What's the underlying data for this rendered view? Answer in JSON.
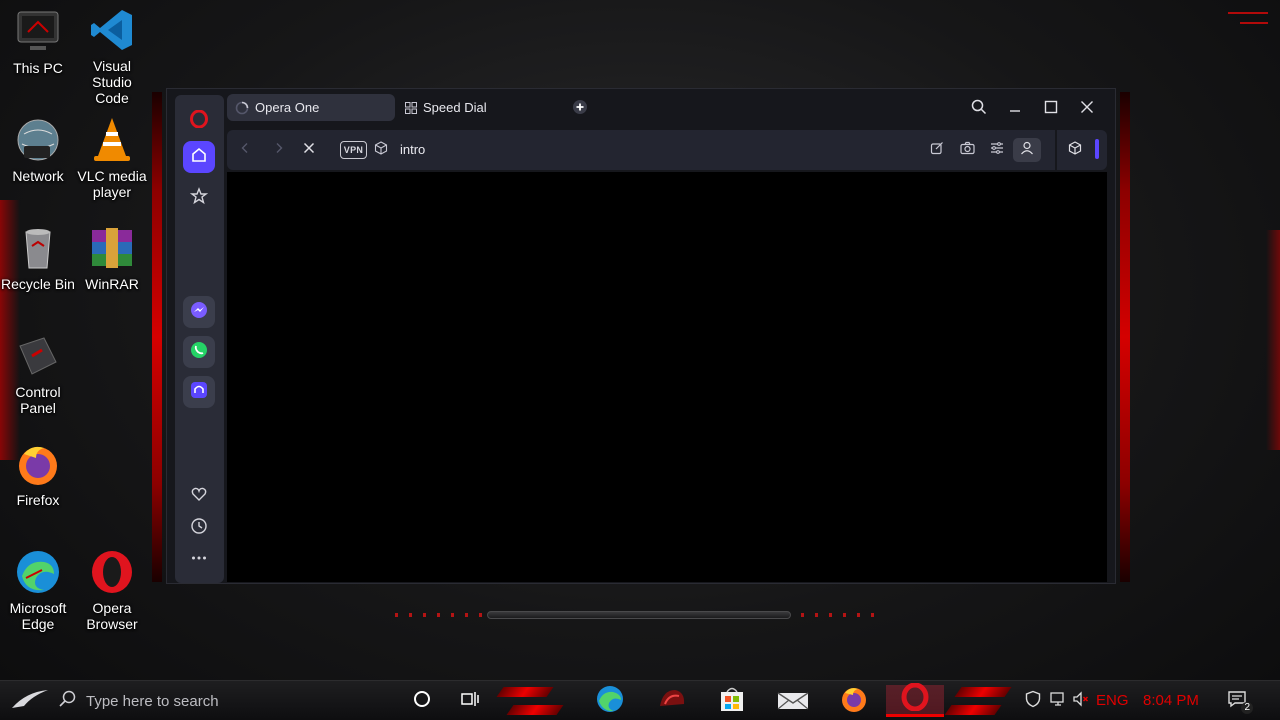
{
  "desktop": {
    "icons": [
      {
        "label": "This PC"
      },
      {
        "label": "Visual Studio Code"
      },
      {
        "label": "Network"
      },
      {
        "label": "VLC media player"
      },
      {
        "label": "Recycle Bin"
      },
      {
        "label": "WinRAR"
      },
      {
        "label": "Control Panel"
      },
      {
        "label": "Firefox"
      },
      {
        "label": "Microsoft Edge"
      },
      {
        "label": "Opera Browser"
      }
    ]
  },
  "browser": {
    "tabs": [
      {
        "label": "Opera One",
        "icon": "loading-spinner-icon",
        "active": true
      },
      {
        "label": "Speed Dial",
        "icon": "grid-icon",
        "active": false
      }
    ],
    "vpn_label": "VPN",
    "url": "intro",
    "accent_color": "#5b46ff",
    "sidebar": {
      "top": [
        "opera-logo-icon",
        "home-icon",
        "bookmark-star-icon"
      ],
      "apps": [
        "messenger-icon",
        "whatsapp-icon",
        "aria-ai-icon"
      ],
      "bottom": [
        "heart-icon",
        "history-clock-icon",
        "more-dots-icon"
      ]
    }
  },
  "taskbar": {
    "search_placeholder": "Type here to search",
    "language": "ENG",
    "time": "8:04 PM",
    "notification_count": "2",
    "accent_color": "#e00000"
  }
}
